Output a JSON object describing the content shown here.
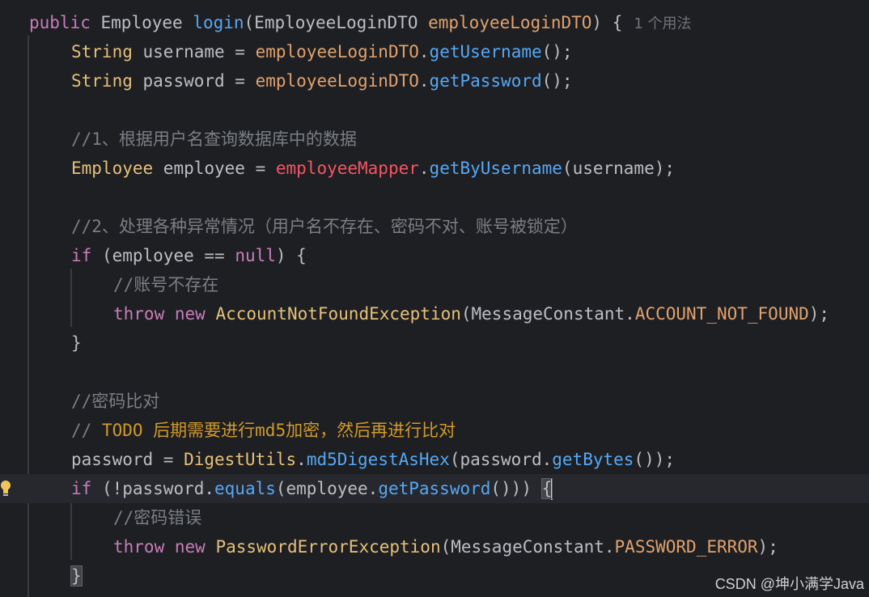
{
  "editor": {
    "usage_hint": "1 个用法",
    "lines": [
      {
        "segments": [
          {
            "c": "kwp",
            "t": "public "
          },
          {
            "c": "plain",
            "t": "Employee "
          },
          {
            "c": "mtd",
            "t": "login"
          },
          {
            "c": "plain",
            "t": "(EmployeeLoginDTO "
          },
          {
            "c": "prm",
            "t": "employeeLoginDTO"
          },
          {
            "c": "plain",
            "t": ") {"
          }
        ]
      },
      {
        "segments": [
          {
            "c": "typ",
            "t": "String "
          },
          {
            "c": "plain",
            "t": "username = "
          },
          {
            "c": "prm",
            "t": "employeeLoginDTO"
          },
          {
            "c": "plain",
            "t": "."
          },
          {
            "c": "mtd",
            "t": "getUsername"
          },
          {
            "c": "plain",
            "t": "();"
          }
        ]
      },
      {
        "segments": [
          {
            "c": "typ",
            "t": "String "
          },
          {
            "c": "plain",
            "t": "password = "
          },
          {
            "c": "prm",
            "t": "employeeLoginDTO"
          },
          {
            "c": "plain",
            "t": "."
          },
          {
            "c": "mtd",
            "t": "getPassword"
          },
          {
            "c": "plain",
            "t": "();"
          }
        ]
      },
      {
        "segments": []
      },
      {
        "segments": [
          {
            "c": "cmt",
            "t": "//1、根据用户名查询数据库中的数据"
          }
        ]
      },
      {
        "segments": [
          {
            "c": "typ",
            "t": "Employee "
          },
          {
            "c": "plain",
            "t": "employee = "
          },
          {
            "c": "err",
            "t": "employeeMapper"
          },
          {
            "c": "plain",
            "t": "."
          },
          {
            "c": "mtd",
            "t": "getByUsername"
          },
          {
            "c": "plain",
            "t": "(username);"
          }
        ]
      },
      {
        "segments": []
      },
      {
        "segments": [
          {
            "c": "cmt",
            "t": "//2、处理各种异常情况（用户名不存在、密码不对、账号被锁定）"
          }
        ]
      },
      {
        "segments": [
          {
            "c": "kwp",
            "t": "if "
          },
          {
            "c": "plain",
            "t": "(employee == "
          },
          {
            "c": "kwc",
            "t": "null"
          },
          {
            "c": "plain",
            "t": ") {"
          }
        ]
      },
      {
        "segments": [
          {
            "c": "cmt",
            "t": "//账号不存在"
          }
        ]
      },
      {
        "segments": [
          {
            "c": "kwp",
            "t": "throw "
          },
          {
            "c": "kwp",
            "t": "new "
          },
          {
            "c": "typ",
            "t": "AccountNotFoundException"
          },
          {
            "c": "plain",
            "t": "(MessageConstant."
          },
          {
            "c": "prm",
            "t": "ACCOUNT_NOT_FOUND"
          },
          {
            "c": "plain",
            "t": ");"
          }
        ]
      },
      {
        "segments": [
          {
            "c": "plain",
            "t": "}"
          }
        ]
      },
      {
        "segments": []
      },
      {
        "segments": [
          {
            "c": "cmt",
            "t": "//密码比对"
          }
        ]
      },
      {
        "segments": [
          {
            "c": "cmt",
            "t": "// "
          },
          {
            "c": "todo",
            "t": "TODO 后期需要进行md5加密，然后再进行比对"
          }
        ]
      },
      {
        "segments": [
          {
            "c": "plain",
            "t": "password = "
          },
          {
            "c": "typ",
            "t": "DigestUtils"
          },
          {
            "c": "plain",
            "t": "."
          },
          {
            "c": "mtd",
            "t": "md5DigestAsHex"
          },
          {
            "c": "plain",
            "t": "(password."
          },
          {
            "c": "mtd",
            "t": "getBytes"
          },
          {
            "c": "plain",
            "t": "());"
          }
        ]
      },
      {
        "segments": [
          {
            "c": "kwp",
            "t": "if "
          },
          {
            "c": "plain",
            "t": "(!password."
          },
          {
            "c": "mtd",
            "t": "equals"
          },
          {
            "c": "plain",
            "t": "(employee."
          },
          {
            "c": "mtd",
            "t": "getPassword"
          },
          {
            "c": "plain",
            "t": "())) "
          },
          {
            "c": "brace-hl",
            "t": "{"
          }
        ]
      },
      {
        "segments": [
          {
            "c": "cmt",
            "t": "//密码错误"
          }
        ]
      },
      {
        "segments": [
          {
            "c": "kwp",
            "t": "throw "
          },
          {
            "c": "kwp",
            "t": "new "
          },
          {
            "c": "typ",
            "t": "PasswordErrorException"
          },
          {
            "c": "plain",
            "t": "(MessageConstant."
          },
          {
            "c": "prm",
            "t": "PASSWORD_ERROR"
          },
          {
            "c": "plain",
            "t": ");"
          }
        ]
      },
      {
        "segments": [
          {
            "c": "brace-hl",
            "t": "}"
          }
        ]
      }
    ]
  },
  "watermark": "CSDN @坤小满学Java",
  "icons": {
    "intention_bulb": "lightbulb-icon"
  },
  "colors": {
    "background": "#1e1f22",
    "current_line": "#26282e",
    "keyword": "#cf8e6d",
    "method": "#56a8f5",
    "type": "#e5c07b",
    "comment": "#7a7e85",
    "todo": "#d19a2a",
    "error_field": "#f75464"
  }
}
